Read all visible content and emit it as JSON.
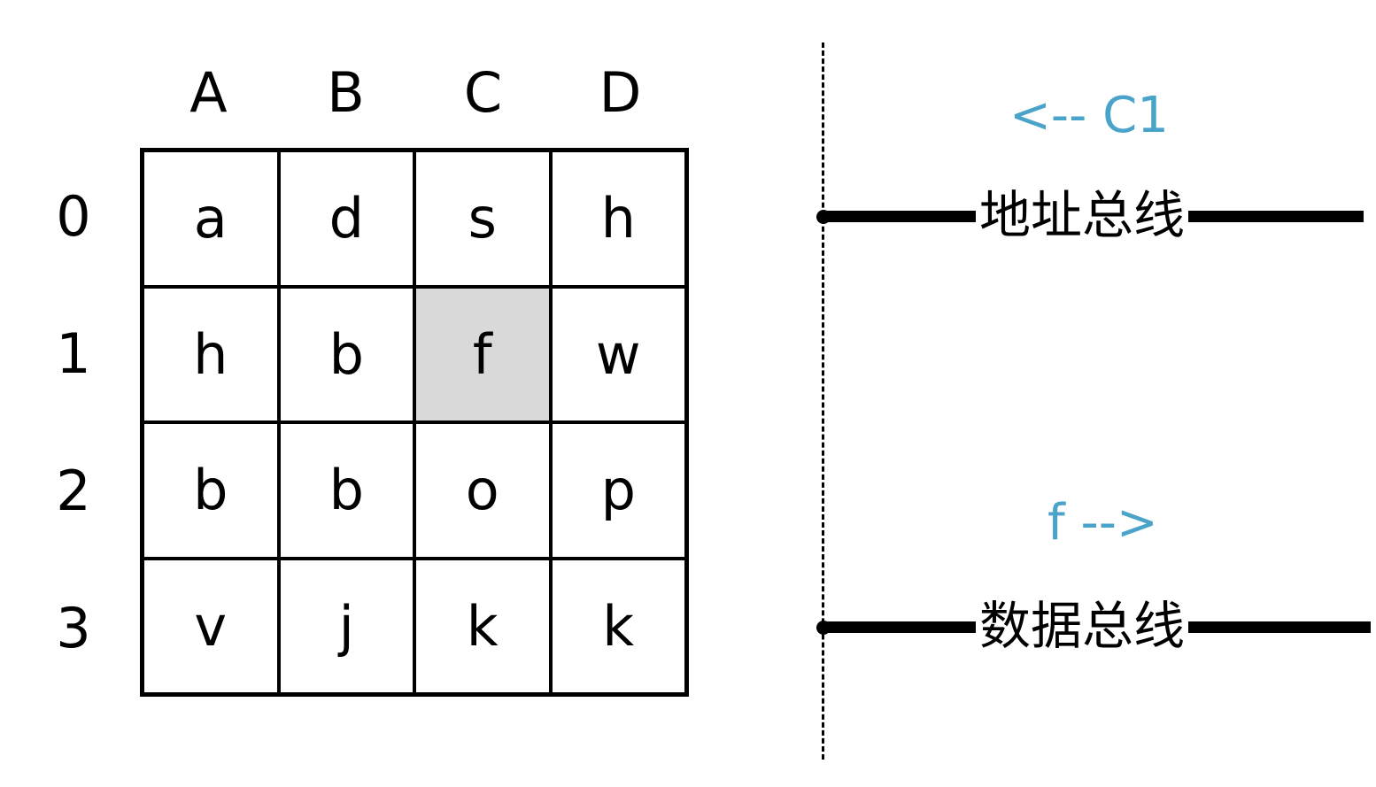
{
  "columns": [
    "A",
    "B",
    "C",
    "D"
  ],
  "rows": [
    "0",
    "1",
    "2",
    "3"
  ],
  "cells": [
    [
      "a",
      "d",
      "s",
      "h"
    ],
    [
      "h",
      "b",
      "f",
      "w"
    ],
    [
      "b",
      "b",
      "o",
      "p"
    ],
    [
      "v",
      "j",
      "k",
      "k"
    ]
  ],
  "highlighted_cell": {
    "row": "1",
    "column": "C",
    "value": "f"
  },
  "highlight_color": "#d9d9d9",
  "address_bus": {
    "label": "地址总线",
    "signal": "<-- C1"
  },
  "data_bus": {
    "label": "数据总线",
    "signal": "f -->"
  },
  "signal_color": "#4aa3c8"
}
